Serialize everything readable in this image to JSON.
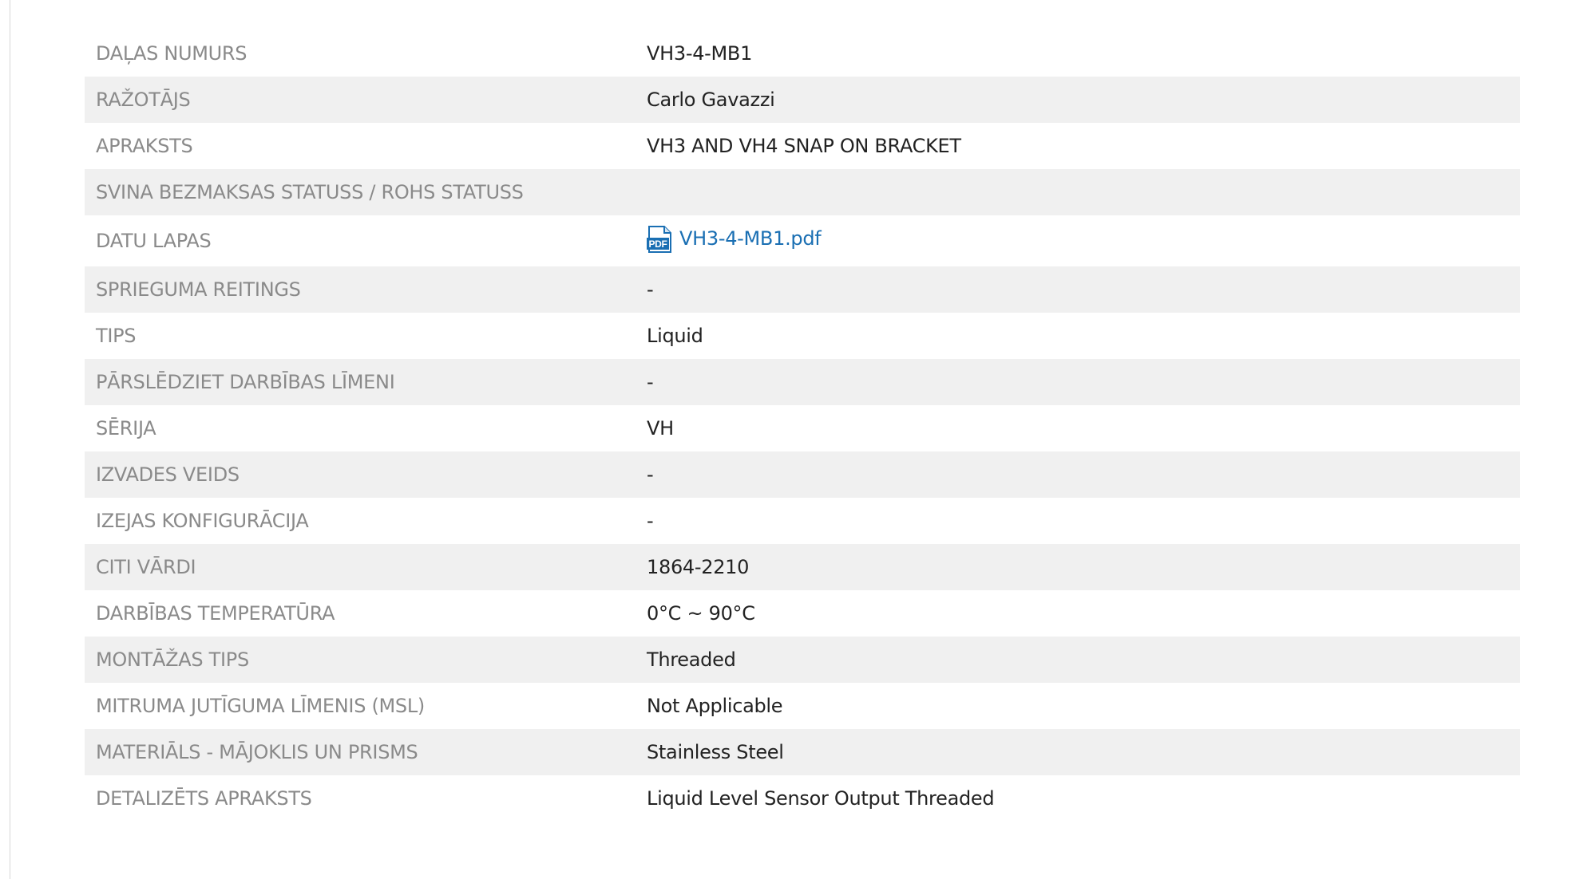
{
  "colors": {
    "label": "#8a8a8a",
    "value": "#222222",
    "link": "#1a6fb3",
    "row_alt_bg": "#f0f0f0",
    "pdf_icon": "#1a6fb3"
  },
  "specs": [
    {
      "label": "DAĻAS NUMURS",
      "value": "VH3-4-MB1"
    },
    {
      "label": "RAŽOTĀJS",
      "value": "Carlo Gavazzi"
    },
    {
      "label": "APRAKSTS",
      "value": "VH3 AND VH4 SNAP ON BRACKET"
    },
    {
      "label": "SVINA BEZMAKSAS STATUSS / ROHS STATUSS",
      "value": ""
    },
    {
      "label": "DATU LAPAS",
      "value": "VH3-4-MB1.pdf",
      "icon": "pdf-file-icon",
      "icon_text": "PDF"
    },
    {
      "label": "SPRIEGUMA REITINGS",
      "value": "-"
    },
    {
      "label": "TIPS",
      "value": "Liquid"
    },
    {
      "label": "PĀRSLĒDZIET DARBĪBAS LĪMENI",
      "value": "-"
    },
    {
      "label": "SĒRIJA",
      "value": "VH"
    },
    {
      "label": "IZVADES VEIDS",
      "value": "-"
    },
    {
      "label": "IZEJAS KONFIGURĀCIJA",
      "value": "-"
    },
    {
      "label": "CITI VĀRDI",
      "value": "1864-2210"
    },
    {
      "label": "DARBĪBAS TEMPERATŪRA",
      "value": "0°C ~ 90°C"
    },
    {
      "label": "MONTĀŽAS TIPS",
      "value": "Threaded"
    },
    {
      "label": "MITRUMA JUTĪGUMA LĪMENIS (MSL)",
      "value": "Not Applicable"
    },
    {
      "label": "MATERIĀLS - MĀJOKLIS UN PRISMS",
      "value": "Stainless Steel"
    },
    {
      "label": "DETALIZĒTS APRAKSTS",
      "value": "Liquid Level Sensor Output Threaded"
    }
  ]
}
